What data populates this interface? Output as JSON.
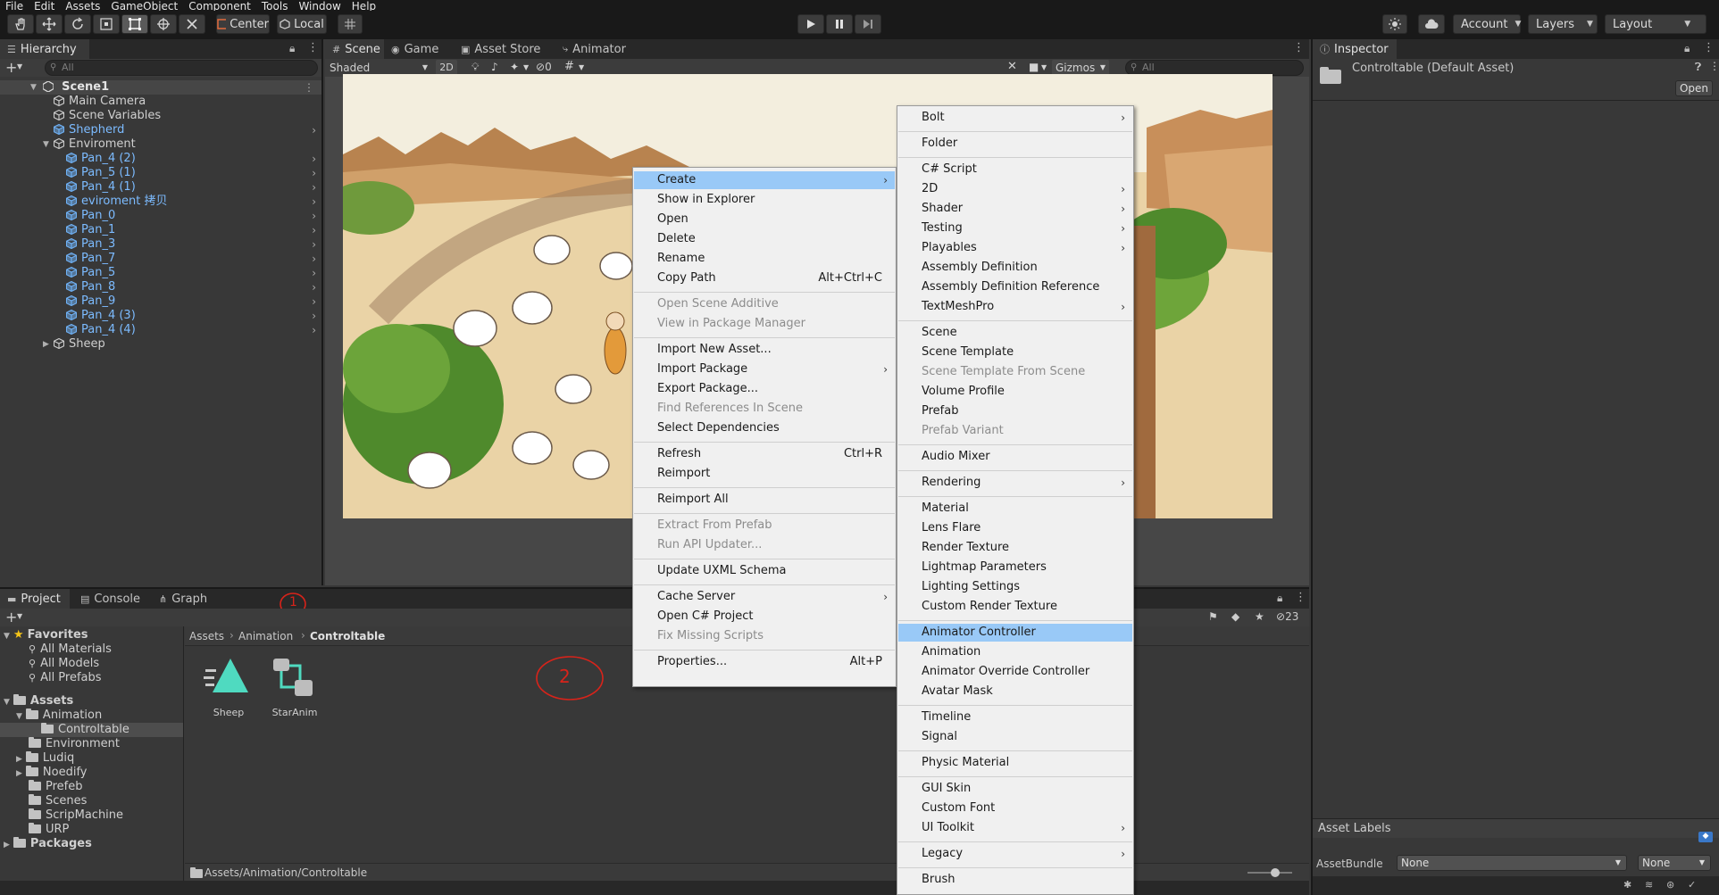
{
  "menubar": [
    "File",
    "Edit",
    "Assets",
    "GameObject",
    "Component",
    "Tools",
    "Window",
    "Help"
  ],
  "toolbar": {
    "pivot": "Center",
    "space": "Local",
    "account": "Account",
    "layers": "Layers",
    "layout": "Layout"
  },
  "hierarchy": {
    "tab": "Hierarchy",
    "search_placeholder": "All",
    "scene": "Scene1",
    "items": [
      "Main Camera",
      "Scene Variables",
      "Shepherd",
      "Enviroment",
      "Pan_4 (2)",
      "Pan_5 (1)",
      "Pan_4 (1)",
      "eviroment 拷贝",
      "Pan_0",
      "Pan_1",
      "Pan_3",
      "Pan_7",
      "Pan_5",
      "Pan_8",
      "Pan_9",
      "Pan_4 (3)",
      "Pan_4 (4)",
      "Sheep"
    ]
  },
  "scene": {
    "tabs": [
      "Scene",
      "Game",
      "Asset Store",
      "Animator"
    ],
    "shading": "Shaded",
    "mode_2d": "2D",
    "hidden_count": "0",
    "gizmos": "Gizmos",
    "search_placeholder": "All"
  },
  "inspector": {
    "tab": "Inspector",
    "asset_title": "Controltable (Default Asset)",
    "open_button": "Open",
    "asset_labels": "Asset Labels",
    "assetbundle_label": "AssetBundle",
    "assetbundle_value": "None",
    "variant_value": "None"
  },
  "project": {
    "tabs": [
      "Project",
      "Console",
      "Graph"
    ],
    "hidden_count": "23",
    "favorites_label": "Favorites",
    "favorites": [
      "All Materials",
      "All Models",
      "All Prefabs"
    ],
    "assets_label": "Assets",
    "tree": [
      "Animation",
      "Controltable",
      "Environment",
      "Ludiq",
      "Noedify",
      "Prefeb",
      "Scenes",
      "ScripMachine",
      "URP"
    ],
    "packages_label": "Packages",
    "breadcrumb": [
      "Assets",
      "Animation",
      "Controltable"
    ],
    "files": [
      "Sheep",
      "StarAnim"
    ],
    "status_path": "Assets/Animation/Controltable",
    "annotation_1": "1",
    "annotation_2": "2"
  },
  "context_menu": {
    "items": [
      {
        "label": "Create",
        "submenu": true,
        "highlight": true
      },
      {
        "label": "Show in Explorer"
      },
      {
        "label": "Open"
      },
      {
        "label": "Delete"
      },
      {
        "label": "Rename"
      },
      {
        "label": "Copy Path",
        "shortcut": "Alt+Ctrl+C"
      },
      {
        "label": "Open Scene Additive",
        "disabled": true
      },
      {
        "label": "View in Package Manager",
        "disabled": true
      },
      {
        "label": "Import New Asset..."
      },
      {
        "label": "Import Package",
        "submenu": true
      },
      {
        "label": "Export Package..."
      },
      {
        "label": "Find References In Scene",
        "disabled": true
      },
      {
        "label": "Select Dependencies"
      },
      {
        "label": "Refresh",
        "shortcut": "Ctrl+R"
      },
      {
        "label": "Reimport"
      },
      {
        "label": "Reimport All"
      },
      {
        "label": "Extract From Prefab",
        "disabled": true
      },
      {
        "label": "Run API Updater...",
        "disabled": true
      },
      {
        "label": "Update UXML Schema"
      },
      {
        "label": "Cache Server",
        "submenu": true
      },
      {
        "label": "Open C# Project"
      },
      {
        "label": "Fix Missing Scripts",
        "disabled": true
      },
      {
        "label": "Properties...",
        "shortcut": "Alt+P"
      }
    ]
  },
  "create_submenu": {
    "items": [
      {
        "label": "Bolt",
        "submenu": true
      },
      {
        "label": "Folder"
      },
      {
        "label": "C# Script"
      },
      {
        "label": "2D",
        "submenu": true
      },
      {
        "label": "Shader",
        "submenu": true
      },
      {
        "label": "Testing",
        "submenu": true
      },
      {
        "label": "Playables",
        "submenu": true
      },
      {
        "label": "Assembly Definition"
      },
      {
        "label": "Assembly Definition Reference"
      },
      {
        "label": "TextMeshPro",
        "submenu": true
      },
      {
        "label": "Scene"
      },
      {
        "label": "Scene Template"
      },
      {
        "label": "Scene Template From Scene",
        "disabled": true
      },
      {
        "label": "Volume Profile"
      },
      {
        "label": "Prefab"
      },
      {
        "label": "Prefab Variant",
        "disabled": true
      },
      {
        "label": "Audio Mixer"
      },
      {
        "label": "Rendering",
        "submenu": true
      },
      {
        "label": "Material"
      },
      {
        "label": "Lens Flare"
      },
      {
        "label": "Render Texture"
      },
      {
        "label": "Lightmap Parameters"
      },
      {
        "label": "Lighting Settings"
      },
      {
        "label": "Custom Render Texture"
      },
      {
        "label": "Animator Controller",
        "highlight": true
      },
      {
        "label": "Animation"
      },
      {
        "label": "Animator Override Controller"
      },
      {
        "label": "Avatar Mask"
      },
      {
        "label": "Timeline"
      },
      {
        "label": "Signal"
      },
      {
        "label": "Physic Material"
      },
      {
        "label": "GUI Skin"
      },
      {
        "label": "Custom Font"
      },
      {
        "label": "UI Toolkit",
        "submenu": true
      },
      {
        "label": "Legacy",
        "submenu": true
      },
      {
        "label": "Brush"
      }
    ]
  }
}
